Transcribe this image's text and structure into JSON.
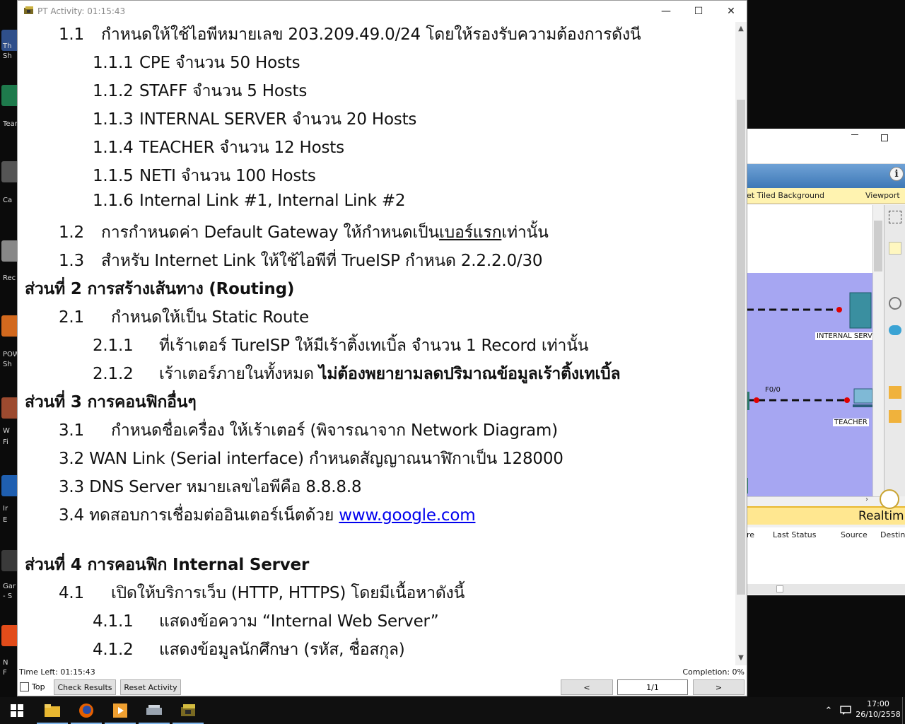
{
  "window": {
    "title": "PT Activity: 01:15:43",
    "controls": {
      "minimize": "—",
      "maximize": "☐",
      "close": "✕"
    }
  },
  "document": {
    "l01": {
      "num": "1.1",
      "text": "กำหนดให้ใช้ไอพีหมายเลข 203.209.49.0/24 โดยให้รองรับความต้องการดังนี"
    },
    "l02": {
      "num": "1.1.1",
      "text": "CPE จำนวน 50 Hosts"
    },
    "l03": {
      "num": "1.1.2",
      "text": "STAFF จำนวน 5 Hosts"
    },
    "l04": {
      "num": "1.1.3",
      "text": "INTERNAL SERVER จำนวน 20 Hosts"
    },
    "l05": {
      "num": "1.1.4",
      "text": "TEACHER จำนวน 12 Hosts"
    },
    "l06": {
      "num": "1.1.5",
      "text": "NETI จำนวน 100 Hosts"
    },
    "l07": {
      "num": "1.1.6",
      "text": "Internal Link #1, Internal Link #2"
    },
    "l08": {
      "num": "1.2",
      "pre": "การกำหนดค่า Default Gateway ให้กำหนดเป็น",
      "ul": "เบอร์แรก",
      "post": "เท่านั้น"
    },
    "l09": {
      "num": "1.3",
      "text": "สำหรับ Internet Link ให้ใช้ไอพีที่ TrueISP กำหนด 2.2.2.0/30"
    },
    "l10": {
      "text": "ส่วนที่ 2 การสร้างเส้นทาง (Routing)"
    },
    "l11": {
      "num": "2.1",
      "text": "กำหนดให้เป็น Static Route"
    },
    "l12": {
      "num": "2.1.1",
      "text": "ที่เร้าเตอร์ TureISP ให้มีเร้าติ้งเทเบิ้ล จำนวน 1 Record เท่านั้น"
    },
    "l13": {
      "num": "2.1.2",
      "text": "เร้าเตอร์ภายในทั้งหมด ",
      "bold": "ไม่ต้องพยายามลดปริมาณข้อมูลเร้าติ้งเทเบิ้ล"
    },
    "l14": {
      "text": "ส่วนที่ 3 การคอนฟิกอื่นๆ"
    },
    "l15": {
      "num": "3.1",
      "text": "กำหนดชื่อเครื่อง ให้เร้าเตอร์ (พิจารณาจาก Network Diagram)"
    },
    "l16": {
      "text": "3.2 WAN Link (Serial interface) กำหนดสัญญาณนาฬิกาเป็น 128000"
    },
    "l17": {
      "text": "3.3 DNS Server หมายเลขไอพีคือ 8.8.8.8"
    },
    "l18": {
      "pre": "3.4 ทดสอบการเชื่อมต่ออินเตอร์เน็ตด้วย ",
      "link": "www.google.com"
    },
    "l19": {
      "text": "ส่วนที่ 4 การคอนฟิก Internal Server"
    },
    "l20": {
      "num": "4.1",
      "text": "เปิดให้บริการเว็บ (HTTP, HTTPS) โดยมีเนื้อหาดังนี้"
    },
    "l21": {
      "num": "4.1.1",
      "text": "แสดงข้อความ “Internal Web Server”"
    },
    "l22": {
      "num": "4.1.2",
      "text": "แสดงข้อมูลนักศึกษา (รหัส, ชื่อสกุล)"
    }
  },
  "status": {
    "time_left": "Time Left: 01:15:43",
    "completion": "Completion: 0%"
  },
  "footer": {
    "top_label": "Top",
    "top_checked": false,
    "check_results": "Check Results",
    "reset_activity": "Reset Activity",
    "prev": "<",
    "page": "1/1",
    "next": ">"
  },
  "background_window": {
    "toolbar_left": "et Tiled Background",
    "toolbar_right": "Viewport",
    "device_internal": "INTERNAL SERV",
    "device_teacher": "TEACHER",
    "port_label": "F0/0",
    "realtime": "Realtim",
    "events_cols": [
      "re",
      "Last Status",
      "Source",
      "Destin"
    ]
  },
  "desktop_labels": [
    "Th",
    "Sh",
    "Tear",
    "Ca",
    "Rec",
    "POW",
    "Sh",
    "W",
    "Fi",
    "Ir",
    "E",
    "Gar",
    "- S",
    "N",
    "F"
  ],
  "taskbar": {
    "time": "17:00",
    "date": "26/10/2558"
  },
  "colors": {
    "workspace": "#a6a6f2",
    "link": "#0000ee",
    "realtime_bar": "#ffe790",
    "link_dot": "#e00000"
  }
}
